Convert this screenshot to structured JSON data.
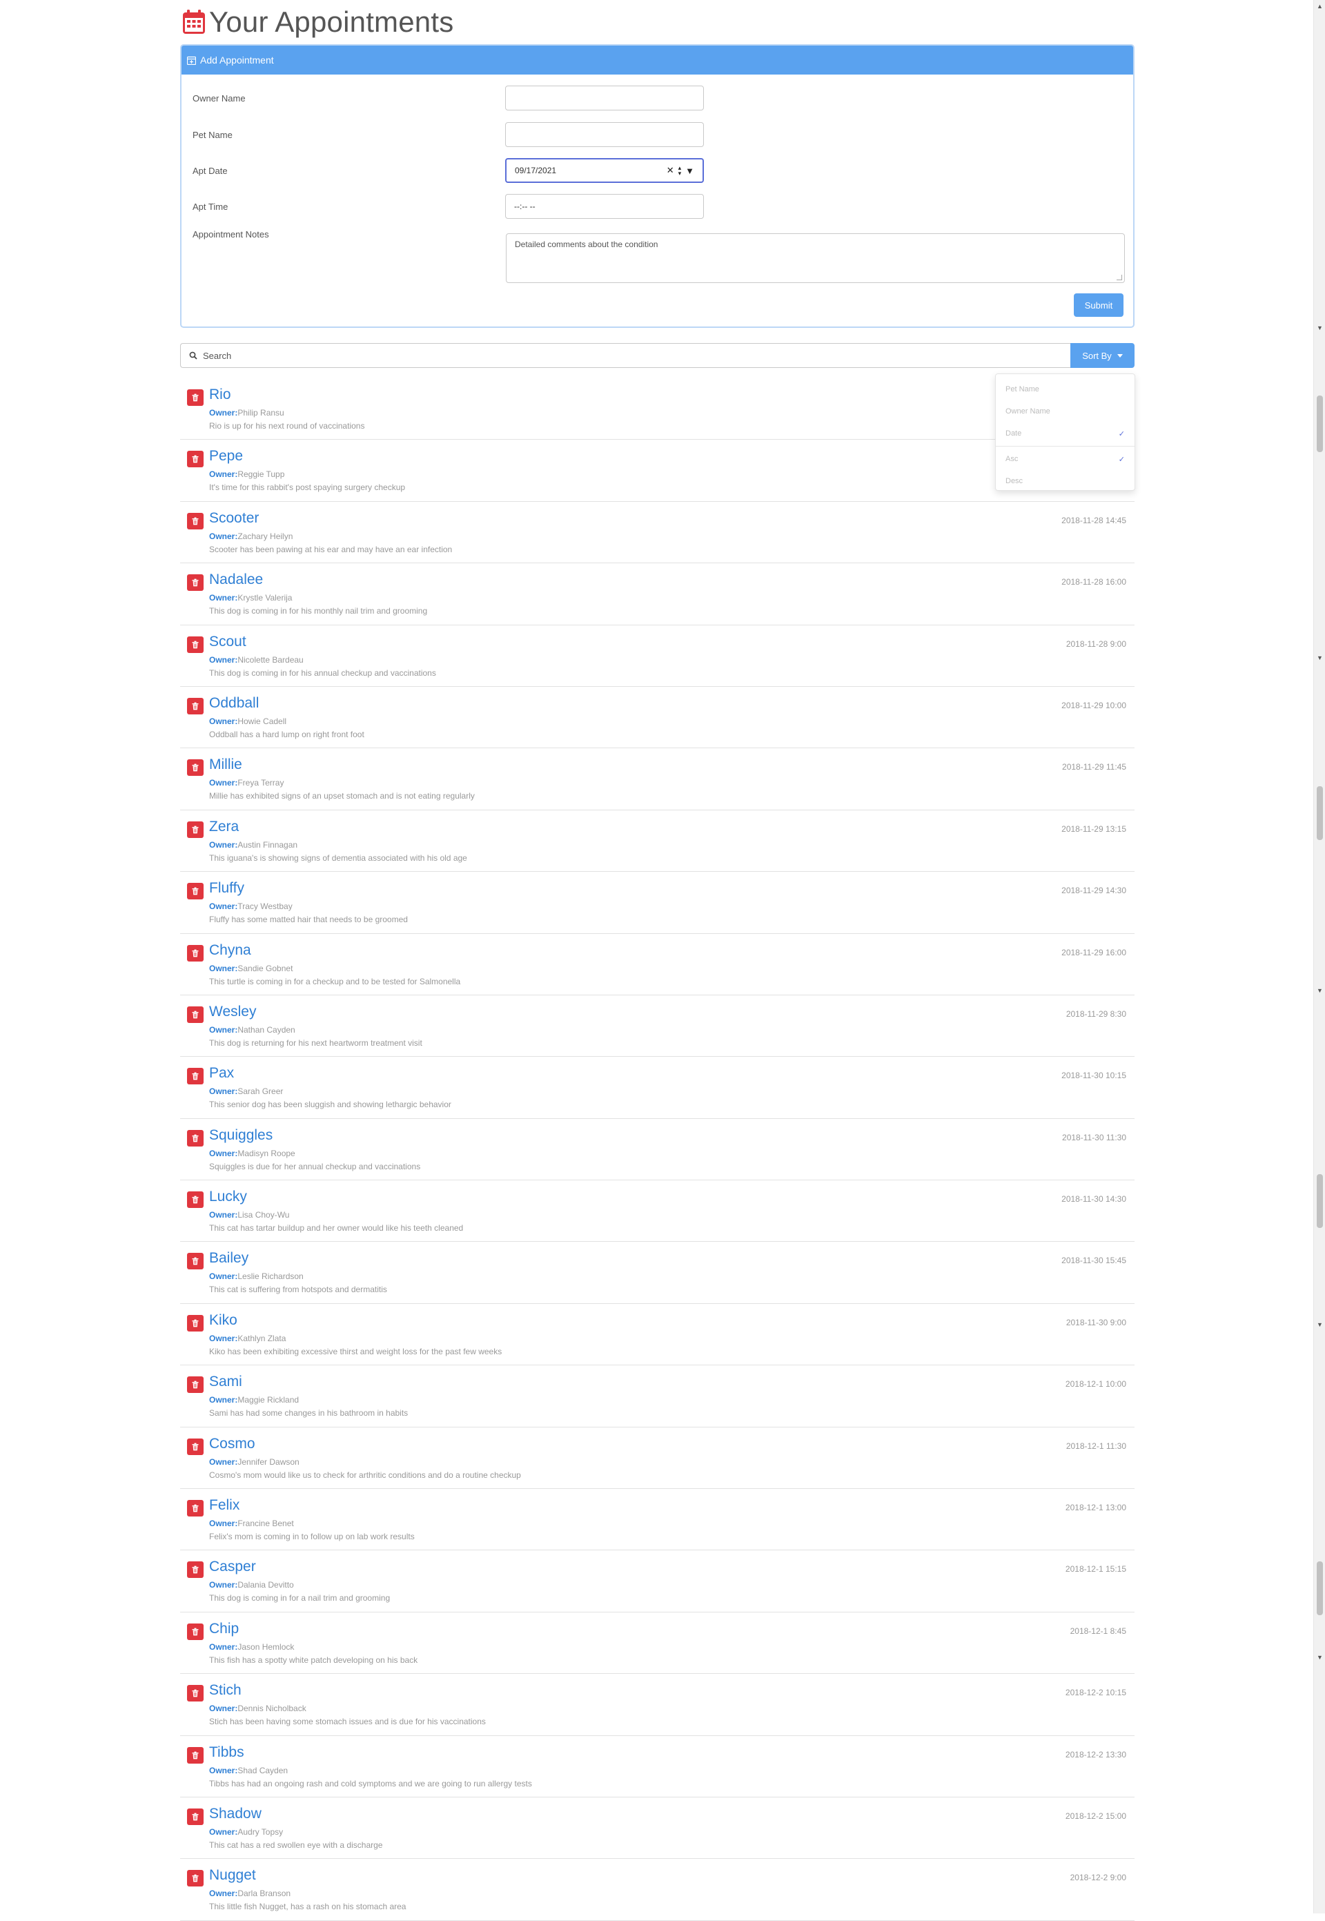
{
  "page": {
    "title": "Your Appointments"
  },
  "form": {
    "header": "Add Appointment",
    "owner_label": "Owner Name",
    "owner_value": "",
    "pet_label": "Pet Name",
    "pet_value": "",
    "date_label": "Apt Date",
    "date_value": "09/17/2021",
    "time_label": "Apt Time",
    "time_value": "--:-- --",
    "notes_label": "Appointment Notes",
    "notes_placeholder": "Detailed comments about the condition",
    "submit_label": "Submit"
  },
  "search": {
    "placeholder": "Search",
    "sort_label": "Sort By"
  },
  "sort_menu": {
    "fields": [
      {
        "label": "Pet Name",
        "checked": false
      },
      {
        "label": "Owner Name",
        "checked": false
      },
      {
        "label": "Date",
        "checked": true
      }
    ],
    "orders": [
      {
        "label": "Asc",
        "checked": true
      },
      {
        "label": "Desc",
        "checked": false
      }
    ],
    "check_mark": "✓"
  },
  "owner_prefix": "Owner:",
  "appointments": [
    {
      "pet": "Rio",
      "owner": "Philip Ransu",
      "notes": "Rio is up for his next round of vaccinations",
      "date": ""
    },
    {
      "pet": "Pepe",
      "owner": "Reggie Tupp",
      "notes": "It's time for this rabbit's post spaying surgery checkup",
      "date": ""
    },
    {
      "pet": "Scooter",
      "owner": "Zachary Heilyn",
      "notes": "Scooter has been pawing at his ear and may have an ear infection",
      "date": "2018-11-28 14:45"
    },
    {
      "pet": "Nadalee",
      "owner": "Krystle Valerija",
      "notes": "This dog is coming in for his monthly nail trim and grooming",
      "date": "2018-11-28 16:00"
    },
    {
      "pet": "Scout",
      "owner": "Nicolette Bardeau",
      "notes": "This dog is coming in for his annual checkup and vaccinations",
      "date": "2018-11-28 9:00"
    },
    {
      "pet": "Oddball",
      "owner": "Howie Cadell",
      "notes": "Oddball has a hard lump on right front foot",
      "date": "2018-11-29 10:00"
    },
    {
      "pet": "Millie",
      "owner": "Freya Terray",
      "notes": "Millie has exhibited signs of an upset stomach and is not eating regularly",
      "date": "2018-11-29 11:45"
    },
    {
      "pet": "Zera",
      "owner": "Austin Finnagan",
      "notes": "This iguana's is showing signs of dementia associated with his old age",
      "date": "2018-11-29 13:15"
    },
    {
      "pet": "Fluffy",
      "owner": "Tracy Westbay",
      "notes": "Fluffy has some matted hair that needs to be groomed",
      "date": "2018-11-29 14:30"
    },
    {
      "pet": "Chyna",
      "owner": "Sandie Gobnet",
      "notes": "This turtle is coming in for a checkup and to be tested for Salmonella",
      "date": "2018-11-29 16:00"
    },
    {
      "pet": "Wesley",
      "owner": "Nathan Cayden",
      "notes": "This dog is returning for his next heartworm treatment visit",
      "date": "2018-11-29 8:30"
    },
    {
      "pet": "Pax",
      "owner": "Sarah Greer",
      "notes": "This senior dog has been sluggish and showing lethargic behavior",
      "date": "2018-11-30 10:15"
    },
    {
      "pet": "Squiggles",
      "owner": "Madisyn Roope",
      "notes": "Squiggles is due for her annual checkup and vaccinations",
      "date": "2018-11-30 11:30"
    },
    {
      "pet": "Lucky",
      "owner": "Lisa Choy-Wu",
      "notes": "This cat has tartar buildup and her owner would like his teeth cleaned",
      "date": "2018-11-30 14:30"
    },
    {
      "pet": "Bailey",
      "owner": "Leslie Richardson",
      "notes": "This cat is suffering from hotspots and dermatitis",
      "date": "2018-11-30 15:45"
    },
    {
      "pet": "Kiko",
      "owner": "Kathlyn Zlata",
      "notes": "Kiko has been exhibiting excessive thirst and weight loss for the past few weeks",
      "date": "2018-11-30 9:00"
    },
    {
      "pet": "Sami",
      "owner": "Maggie Rickland",
      "notes": "Sami has had some changes in his bathroom in habits",
      "date": "2018-12-1 10:00"
    },
    {
      "pet": "Cosmo",
      "owner": "Jennifer Dawson",
      "notes": "Cosmo's mom would like us to check for arthritic conditions and do a routine checkup",
      "date": "2018-12-1 11:30"
    },
    {
      "pet": "Felix",
      "owner": "Francine Benet",
      "notes": "Felix's mom is coming in to follow up on lab work results",
      "date": "2018-12-1 13:00"
    },
    {
      "pet": "Casper",
      "owner": "Dalania Devitto",
      "notes": "This dog is coming in for a nail trim and grooming",
      "date": "2018-12-1 15:15"
    },
    {
      "pet": "Chip",
      "owner": "Jason Hemlock",
      "notes": "This fish has a spotty white patch developing on his back",
      "date": "2018-12-1 8:45"
    },
    {
      "pet": "Stich",
      "owner": "Dennis Nicholback",
      "notes": "Stich has been having some stomach issues and is due for his vaccinations",
      "date": "2018-12-2 10:15"
    },
    {
      "pet": "Tibbs",
      "owner": "Shad Cayden",
      "notes": "Tibbs has had an ongoing rash and cold symptoms and we are going to run allergy tests",
      "date": "2018-12-2 13:30"
    },
    {
      "pet": "Shadow",
      "owner": "Audry Topsy",
      "notes": "This cat has a red swollen eye with a discharge",
      "date": "2018-12-2 15:00"
    },
    {
      "pet": "Nugget",
      "owner": "Darla Branson",
      "notes": "This little fish Nugget, has a rash on his stomach area",
      "date": "2018-12-2 9:00"
    }
  ],
  "colors": {
    "accent": "#5aa2ef",
    "link": "#2f7fd4",
    "delete": "#e0363e",
    "title_icon": "#e0363e"
  }
}
